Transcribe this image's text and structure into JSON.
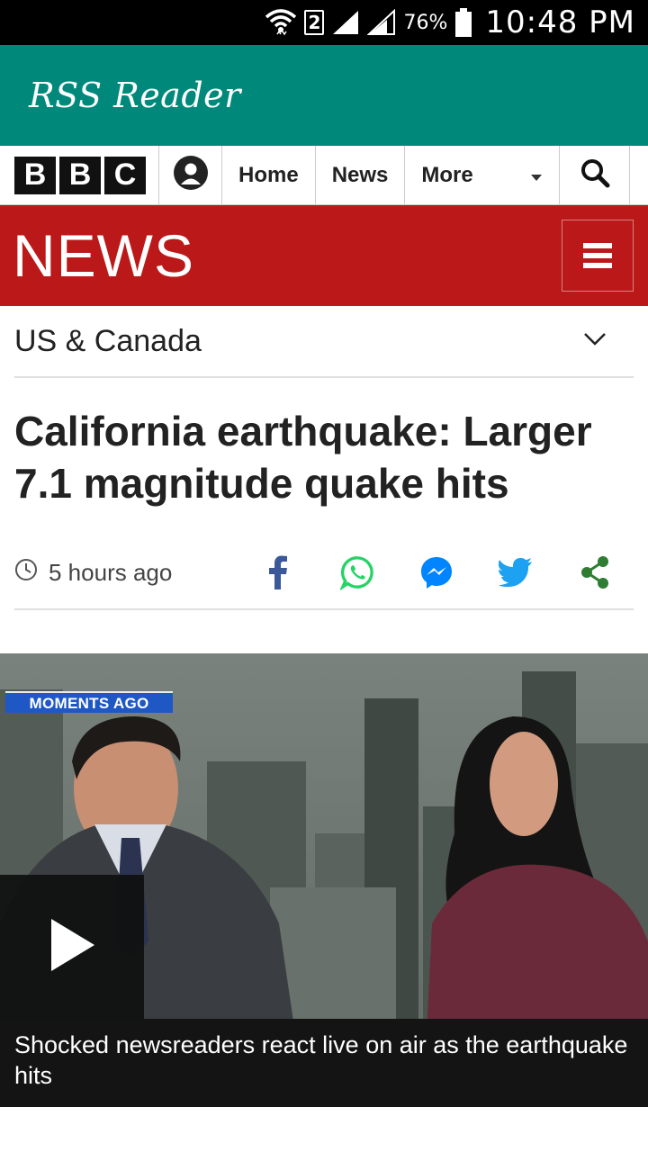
{
  "status_bar": {
    "sim_badge": "2",
    "battery": "76%",
    "time": "10:48 PM"
  },
  "app_bar": {
    "title": "RSS Reader"
  },
  "bbc_nav": {
    "logo_letters": [
      "B",
      "B",
      "C"
    ],
    "home": "Home",
    "news": "News",
    "more": "More"
  },
  "news_banner": {
    "title": "NEWS"
  },
  "section": {
    "label": "US & Canada"
  },
  "article": {
    "headline": "California earthquake: Larger 7.1 magnitude quake hits",
    "timestamp": "5 hours ago"
  },
  "share": {
    "icons": [
      "facebook-icon",
      "whatsapp-icon",
      "messenger-icon",
      "twitter-icon",
      "share-icon"
    ],
    "colors": {
      "facebook": "#3b5998",
      "whatsapp": "#25d366",
      "messenger": "#0084ff",
      "twitter": "#1da1f2",
      "share": "#2e7d32"
    }
  },
  "video": {
    "badge": "MOMENTS AGO",
    "caption": "Shocked newsreaders react live on air as the earthquake hits"
  },
  "colors": {
    "app_bar": "#00897b",
    "news_red": "#bb1919"
  }
}
